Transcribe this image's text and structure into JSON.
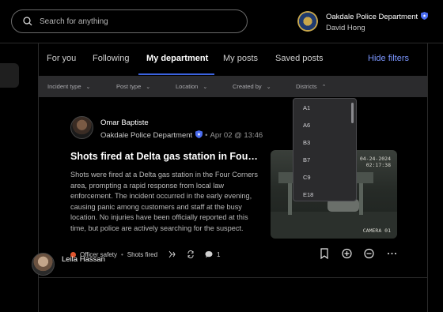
{
  "search": {
    "placeholder": "Search for anything"
  },
  "account": {
    "department": "Oakdale Police Department",
    "user": "David Hong"
  },
  "tabs": [
    {
      "label": "For you"
    },
    {
      "label": "Following"
    },
    {
      "label": "My department",
      "active": true
    },
    {
      "label": "My posts"
    },
    {
      "label": "Saved posts"
    }
  ],
  "hide_filters_label": "Hide filters",
  "filters": [
    {
      "label": "Incident type",
      "chevron": "down"
    },
    {
      "label": "Post type",
      "chevron": "down"
    },
    {
      "label": "Location",
      "chevron": "down"
    },
    {
      "label": "Created by",
      "chevron": "down"
    },
    {
      "label": "Districts",
      "chevron": "up"
    }
  ],
  "districts_dropdown": {
    "options": [
      "A1",
      "A6",
      "B3",
      "B7",
      "C9",
      "E18"
    ]
  },
  "post": {
    "author": "Omar Baptiste",
    "department": "Oakdale Police Department",
    "date": "Apr 02 @ 13:46",
    "title": "Shots fired at Delta gas station in Four Corners",
    "body": "Shots were fired at a Delta gas station in the Four Corners area, prompting a rapid response from local law enforcement. The incident occurred in the early evening, causing panic among customers and staff at the busy location. No injuries have been officially reported at this time, but police are actively searching for the suspect.",
    "tags": [
      "Officer safety",
      "Shots fired"
    ],
    "tag_color": "#e0552e",
    "comment_count": "1",
    "image": {
      "timestamp_date": "04-24-2024",
      "timestamp_time": "02:17:38",
      "camera": "CAMERA 01"
    }
  },
  "post2": {
    "author": "Leila Hassan"
  },
  "colors": {
    "accent": "#3b63e0",
    "link": "#7b96ff",
    "filter_bar": "#2b2b2d"
  }
}
